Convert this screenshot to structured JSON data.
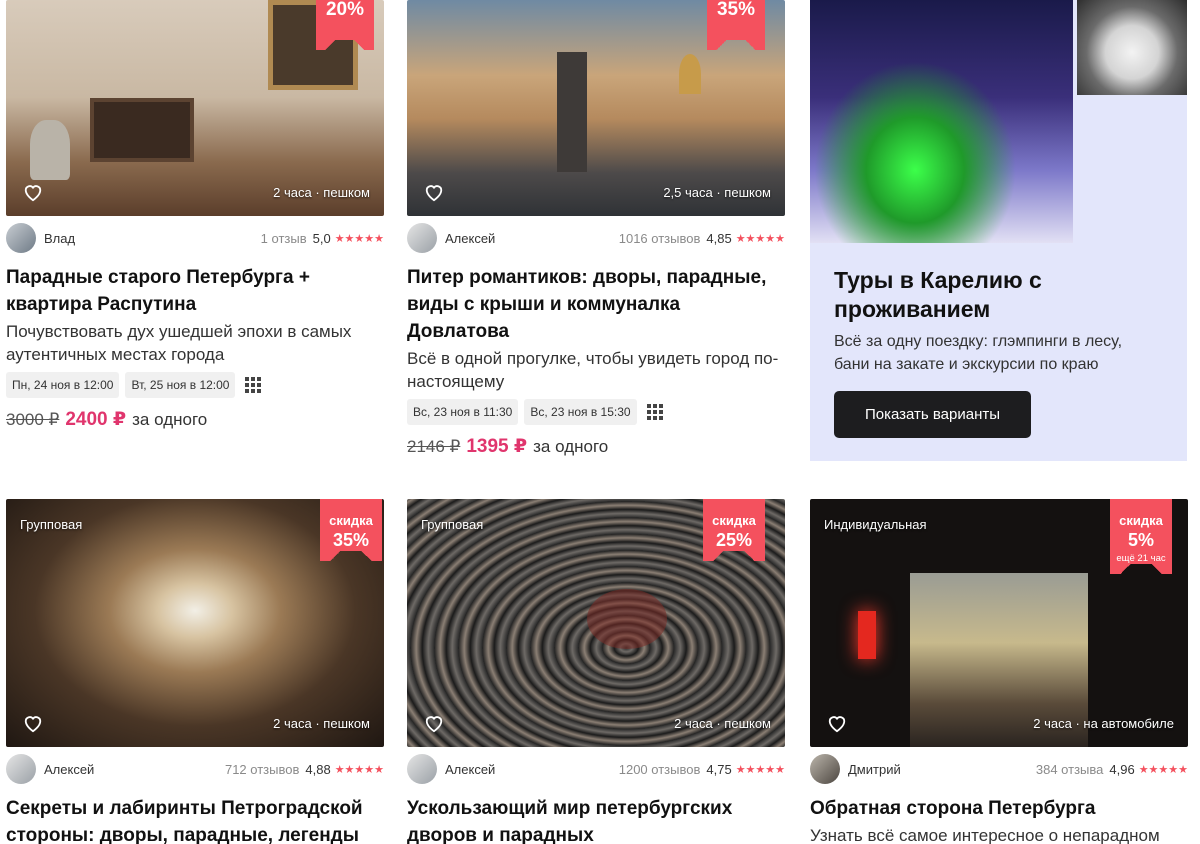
{
  "cards": [
    {
      "discount": "20%",
      "duration": "2 часа · пешком",
      "author": "Влад",
      "reviews": "1 отзыв",
      "rating": "5,0",
      "title": "Парадные старого Петербурга + квартира Распутина",
      "desc": "Почувствовать дух ушедшей эпохи в самых аутентичных местах города",
      "slots": [
        "Пн, 24 ноя в 12:00",
        "Вт, 25 ноя в 12:00"
      ],
      "old_price": "3000 ₽",
      "new_price": "2400 ₽",
      "per": "за одного"
    },
    {
      "discount": "35%",
      "duration": "2,5 часа · пешком",
      "author": "Алексей",
      "reviews": "1016 отзывов",
      "rating": "4,85",
      "title": "Питер романтиков: дворы, парадные, виды с крыши и коммуналка Довлатова",
      "desc": "Всё в одной прогулке, чтобы увидеть город по-настоящему",
      "slots": [
        "Вс, 23 ноя в 11:30",
        "Вс, 23 ноя в 15:30"
      ],
      "old_price": "2146 ₽",
      "new_price": "1395 ₽",
      "per": "за одного"
    },
    {
      "type": "Групповая",
      "ribbon_label": "скидка",
      "discount": "35%",
      "duration": "2 часа · пешком",
      "author": "Алексей",
      "reviews": "712 отзывов",
      "rating": "4,88",
      "title": "Секреты и лабиринты Петроградской стороны: дворы, парадные, легенды"
    },
    {
      "type": "Групповая",
      "ribbon_label": "скидка",
      "discount": "25%",
      "duration": "2 часа · пешком",
      "author": "Алексей",
      "reviews": "1200 отзывов",
      "rating": "4,75",
      "title": "Ускользающий мир петербургских дворов и парадных"
    },
    {
      "type": "Индивидуальная",
      "ribbon_label": "скидка",
      "discount": "5%",
      "ribbon_extra": "ещё 21 час",
      "duration": "2 часа · на автомобиле",
      "author": "Дмитрий",
      "reviews": "384 отзыва",
      "rating": "4,96",
      "title": "Обратная сторона Петербурга",
      "desc": "Узнать всё самое интересное о непарадном"
    }
  ],
  "promo": {
    "title": "Туры в Карелию с проживанием",
    "desc": "Всё за одну поездку: глэмпинги в лесу, бани на закате и экскурсии по краю",
    "button": "Показать варианты"
  },
  "stars": "★★★★★",
  "colors": {
    "accent": "#f4515e",
    "price": "#e0356d",
    "promo_bg": "#e3e6fb",
    "button_bg": "#1d1d1f"
  }
}
